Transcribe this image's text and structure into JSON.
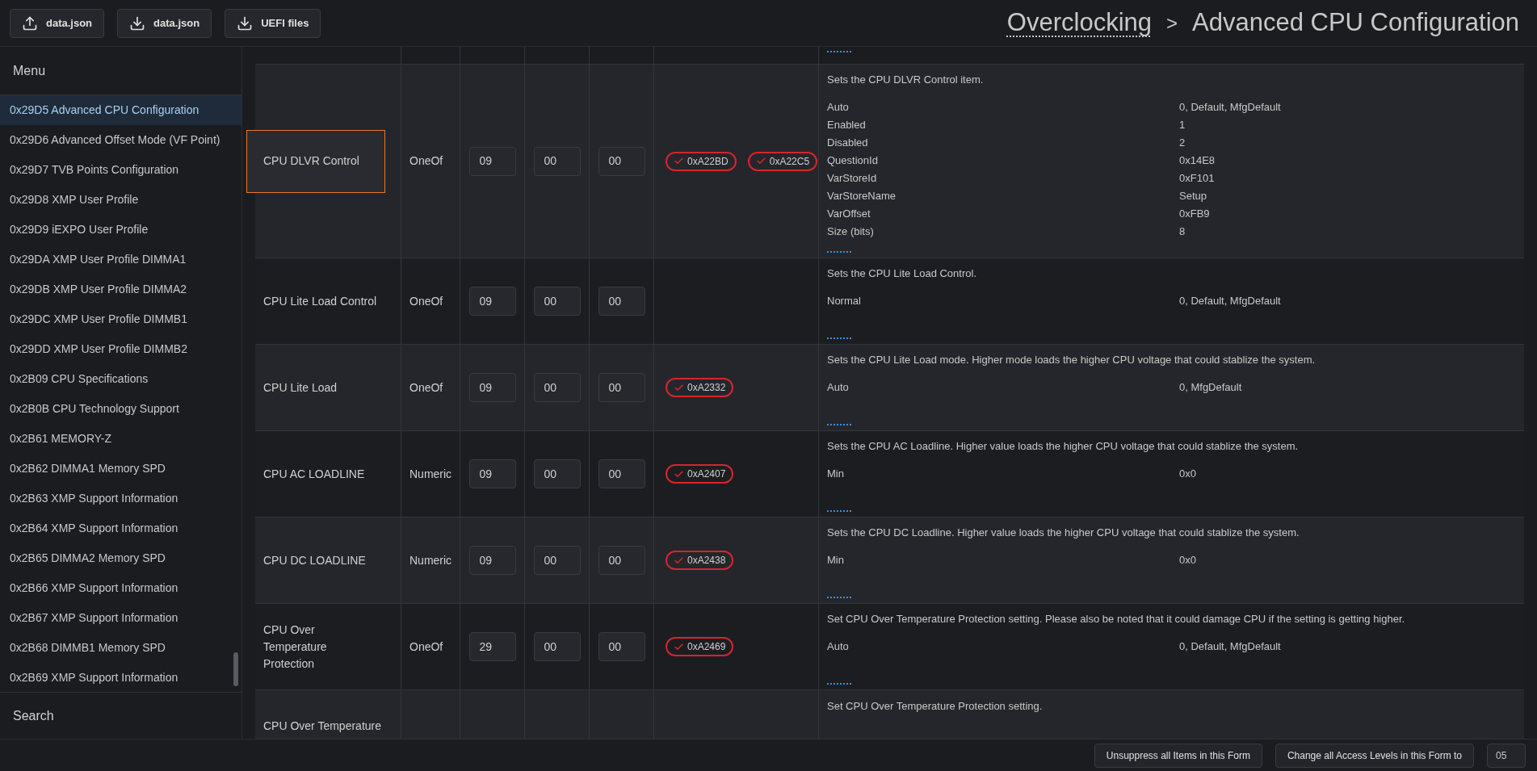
{
  "toolbar": {
    "buttons": [
      {
        "kind": "upload",
        "label": "data.json"
      },
      {
        "kind": "download",
        "label": "data.json"
      },
      {
        "kind": "download",
        "label": "UEFI files"
      }
    ]
  },
  "breadcrumb": [
    {
      "kind": "link",
      "label": "Overclocking"
    },
    {
      "kind": "separator",
      "label": ">"
    },
    {
      "kind": "current",
      "label": "Advanced CPU Configuration"
    }
  ],
  "sidebar": {
    "title": "Menu",
    "items": [
      {
        "label": "0x29D5 Advanced CPU Configuration",
        "selected": true
      },
      {
        "label": "0x29D6 Advanced Offset Mode (VF Point)",
        "selected": false
      },
      {
        "label": "0x29D7 TVB Points Configuration",
        "selected": false
      },
      {
        "label": "0x29D8 XMP User Profile",
        "selected": false
      },
      {
        "label": "0x29D9 iEXPO User Profile",
        "selected": false
      },
      {
        "label": "0x29DA XMP User Profile DIMMA1",
        "selected": false
      },
      {
        "label": "0x29DB XMP User Profile DIMMA2",
        "selected": false
      },
      {
        "label": "0x29DC XMP User Profile DIMMB1",
        "selected": false
      },
      {
        "label": "0x29DD XMP User Profile DIMMB2",
        "selected": false
      },
      {
        "label": "0x2B09 CPU Specifications",
        "selected": false
      },
      {
        "label": "0x2B0B CPU Technology Support",
        "selected": false
      },
      {
        "label": "0x2B61 MEMORY-Z",
        "selected": false
      },
      {
        "label": "0x2B62 DIMMA1 Memory SPD",
        "selected": false
      },
      {
        "label": "0x2B63 XMP Support Information",
        "selected": false
      },
      {
        "label": "0x2B64 XMP Support Information",
        "selected": false
      },
      {
        "label": "0x2B65 DIMMA2 Memory SPD",
        "selected": false
      },
      {
        "label": "0x2B66 XMP Support Information",
        "selected": false
      },
      {
        "label": "0x2B67 XMP Support Information",
        "selected": false
      },
      {
        "label": "0x2B68 DIMMB1 Memory SPD",
        "selected": false
      },
      {
        "label": "0x2B69 XMP Support Information",
        "selected": false
      }
    ],
    "search_label": "Search"
  },
  "table": {
    "rows": [
      {
        "kind": "full",
        "highlighted": true,
        "name": "CPU DLVR Control",
        "type": "OneOf",
        "fields": [
          "09",
          "00",
          "00"
        ],
        "badges": [
          "0xA22BD",
          "0xA22C5"
        ],
        "description": "Sets the CPU DLVR Control item.",
        "properties": [
          {
            "key": "Auto",
            "value": "0, Default, MfgDefault"
          },
          {
            "key": "Enabled",
            "value": "1"
          },
          {
            "key": "Disabled",
            "value": "2"
          },
          {
            "key": "QuestionId",
            "value": "0x14E8"
          },
          {
            "key": "VarStoreId",
            "value": "0xF101"
          },
          {
            "key": "VarStoreName",
            "value": "Setup"
          },
          {
            "key": "VarOffset",
            "value": "0xFB9"
          },
          {
            "key": "Size (bits)",
            "value": "8"
          }
        ]
      },
      {
        "kind": "full",
        "highlighted": false,
        "name": "CPU Lite Load Control",
        "type": "OneOf",
        "fields": [
          "09",
          "00",
          "00"
        ],
        "badges": [],
        "description": "Sets the CPU Lite Load Control.",
        "properties": [
          {
            "key": "Normal",
            "value": "0, Default, MfgDefault"
          }
        ]
      },
      {
        "kind": "full",
        "highlighted": false,
        "name": "CPU Lite Load",
        "type": "OneOf",
        "fields": [
          "09",
          "00",
          "00"
        ],
        "badges": [
          "0xA2332"
        ],
        "description": "Sets the CPU Lite Load mode. Higher mode loads the higher CPU voltage that could stablize the system.",
        "properties": [
          {
            "key": "Auto",
            "value": "0, MfgDefault"
          }
        ]
      },
      {
        "kind": "full",
        "highlighted": false,
        "name": "CPU AC LOADLINE",
        "type": "Numeric",
        "fields": [
          "09",
          "00",
          "00"
        ],
        "badges": [
          "0xA2407"
        ],
        "description": "Sets the CPU AC Loadline. Higher value loads the higher CPU voltage that could stablize the system.",
        "properties": [
          {
            "key": "Min",
            "value": "0x0"
          }
        ]
      },
      {
        "kind": "full",
        "highlighted": false,
        "name": "CPU DC LOADLINE",
        "type": "Numeric",
        "fields": [
          "09",
          "00",
          "00"
        ],
        "badges": [
          "0xA2438"
        ],
        "description": "Sets the CPU DC Loadline. Higher value loads the higher CPU voltage that could stablize the system.",
        "properties": [
          {
            "key": "Min",
            "value": "0x0"
          }
        ]
      },
      {
        "kind": "full",
        "highlighted": false,
        "name": "CPU Over Temperature Protection",
        "type": "OneOf",
        "fields": [
          "29",
          "00",
          "00"
        ],
        "badges": [
          "0xA2469"
        ],
        "description": "Set CPU Over Temperature Protection setting. Please also be noted that it could damage CPU if the setting is getting higher.",
        "properties": [
          {
            "key": "Auto",
            "value": "0, Default, MfgDefault"
          }
        ]
      },
      {
        "kind": "cut",
        "name": "CPU Over Temperature",
        "description": "Set CPU Over Temperature Protection setting."
      }
    ]
  },
  "footer": {
    "buttons": [
      "Unsuppress all Items in this Form",
      "Change all Access Levels in this Form to"
    ],
    "level_value": "05"
  }
}
